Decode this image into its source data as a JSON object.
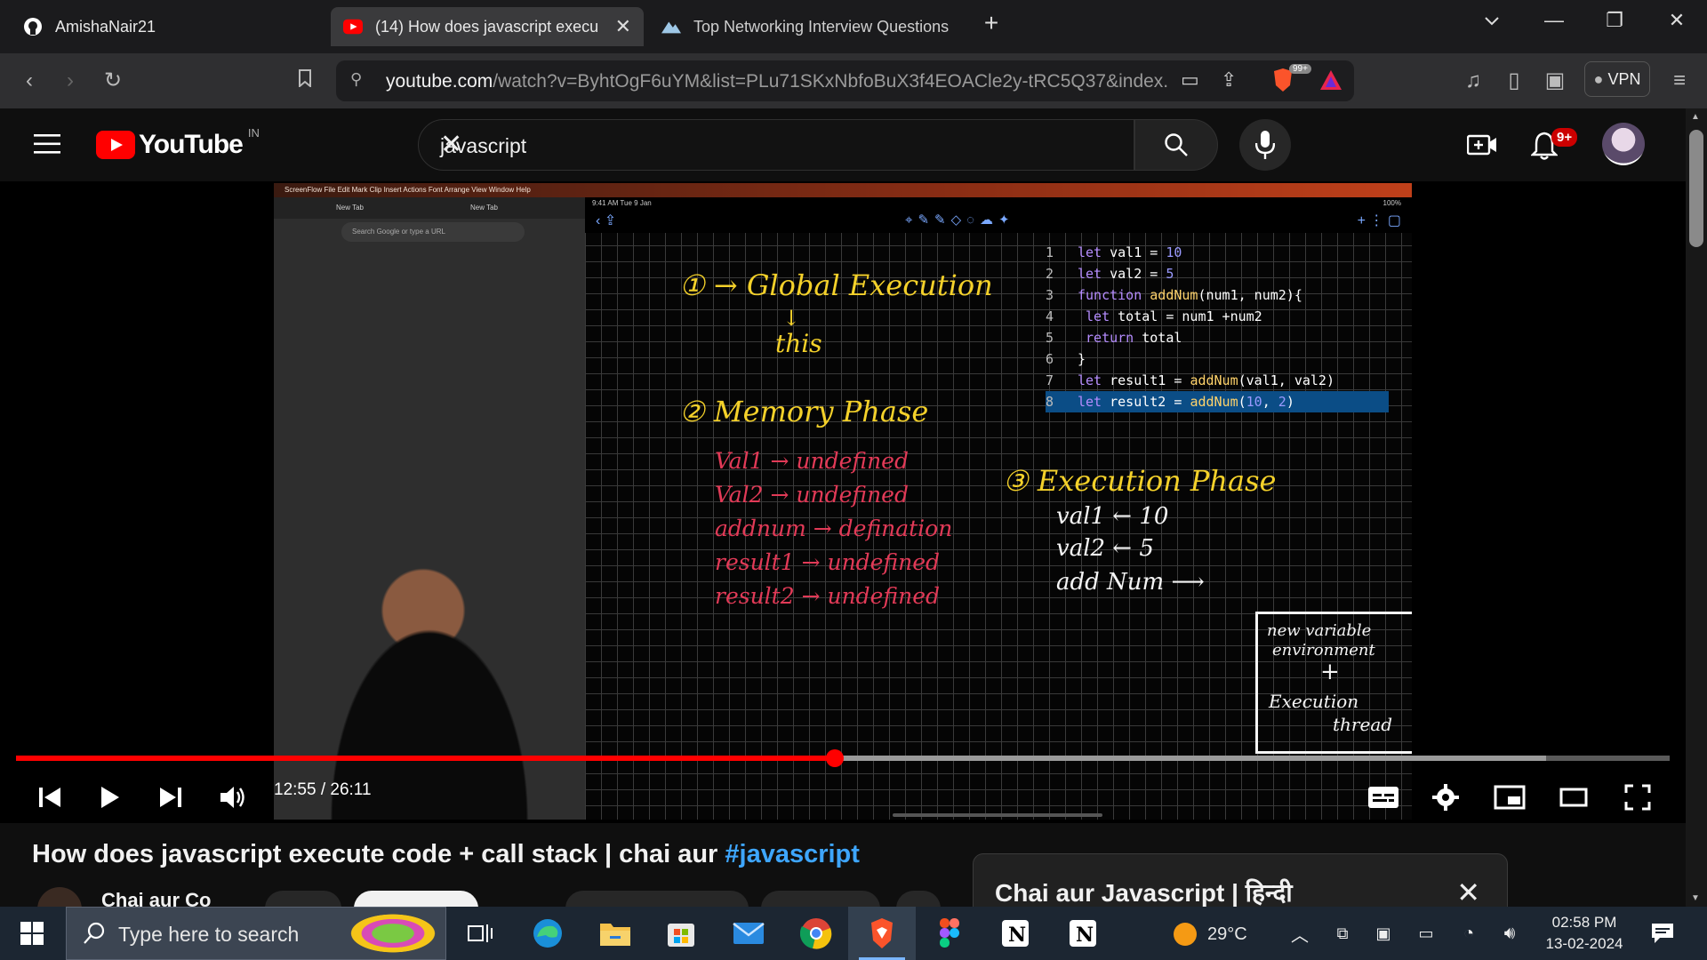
{
  "browser": {
    "tabs": [
      {
        "label": "AmishaNair21",
        "icon": "github-icon"
      },
      {
        "label": "(14) How does javascript execut",
        "icon": "youtube-icon",
        "active": true
      },
      {
        "label": "Top Networking Interview Questions",
        "icon": "site-icon"
      }
    ],
    "new_tab": "+",
    "url_host": "youtube.com",
    "url_rest": "/watch?v=ByhtOgF6uYM&list=PLu71SKxNbfoBuX3f4EOACle2y-tRC5Q37&index...",
    "brave_badge": "99+",
    "vpn_label": "VPN"
  },
  "youtube": {
    "logo_text": "YouTube",
    "region": "IN",
    "search_value": "javascript",
    "notification_count": "9+"
  },
  "video_frame": {
    "mac_menu": "ScreenFlow   File   Edit   Mark   Clip   Insert   Actions   Font   Arrange   View   Window   Help",
    "left_tab_1": "New Tab",
    "left_tab_2": "New Tab",
    "left_addr": "Search Google or type a URL",
    "status_time": "9:41 AM  Tue 9 Jan",
    "battery": "100%",
    "code_lines": [
      {
        "n": "1",
        "text": "let val1 = 10"
      },
      {
        "n": "2",
        "text": "let val2 = 5"
      },
      {
        "n": "3",
        "text": "function addNum(num1, num2){"
      },
      {
        "n": "4",
        "text": "    let total = num1 +num2"
      },
      {
        "n": "5",
        "text": "    return total"
      },
      {
        "n": "6",
        "text": "}"
      },
      {
        "n": "7",
        "text": "let result1 = addNum(val1, val2)"
      },
      {
        "n": "8",
        "text": "let result2 = addNum(10, 2)"
      }
    ],
    "notes": {
      "global": "① → Global Execution",
      "arrow": "↓",
      "this": "this",
      "memory": "② Memory Phase",
      "mem1": "Val1 → undefined",
      "mem2": "Val2 → undefined",
      "mem3": "addnum → defination",
      "mem4": "result1 → undefined",
      "mem5": "result2 → undefined",
      "exec": "③ Execution Phase",
      "ex1": "val1 ← 10",
      "ex2": "val2 ← 5",
      "ex3": "add Num ⟶",
      "box1": "new variable",
      "box2": "environment",
      "box3": "+",
      "box4": "Execution",
      "box5": "thread"
    }
  },
  "player": {
    "time": "12:55 / 26:11",
    "progress_fraction": 0.495,
    "loaded_fraction": 0.925
  },
  "below": {
    "title_text": "How does javascript execute code + call stack | chai aur ",
    "title_hashtag": "#javascript",
    "channel": "Chai aur Co",
    "playlist_title": "Chai aur Javascript | हिन्दी"
  },
  "taskbar": {
    "search_placeholder": "Type here to search",
    "weather": "29°C",
    "time": "02:58 PM",
    "date": "13-02-2024"
  },
  "colors": {
    "yt_red": "#ff0000",
    "link_blue": "#3ea6ff"
  }
}
